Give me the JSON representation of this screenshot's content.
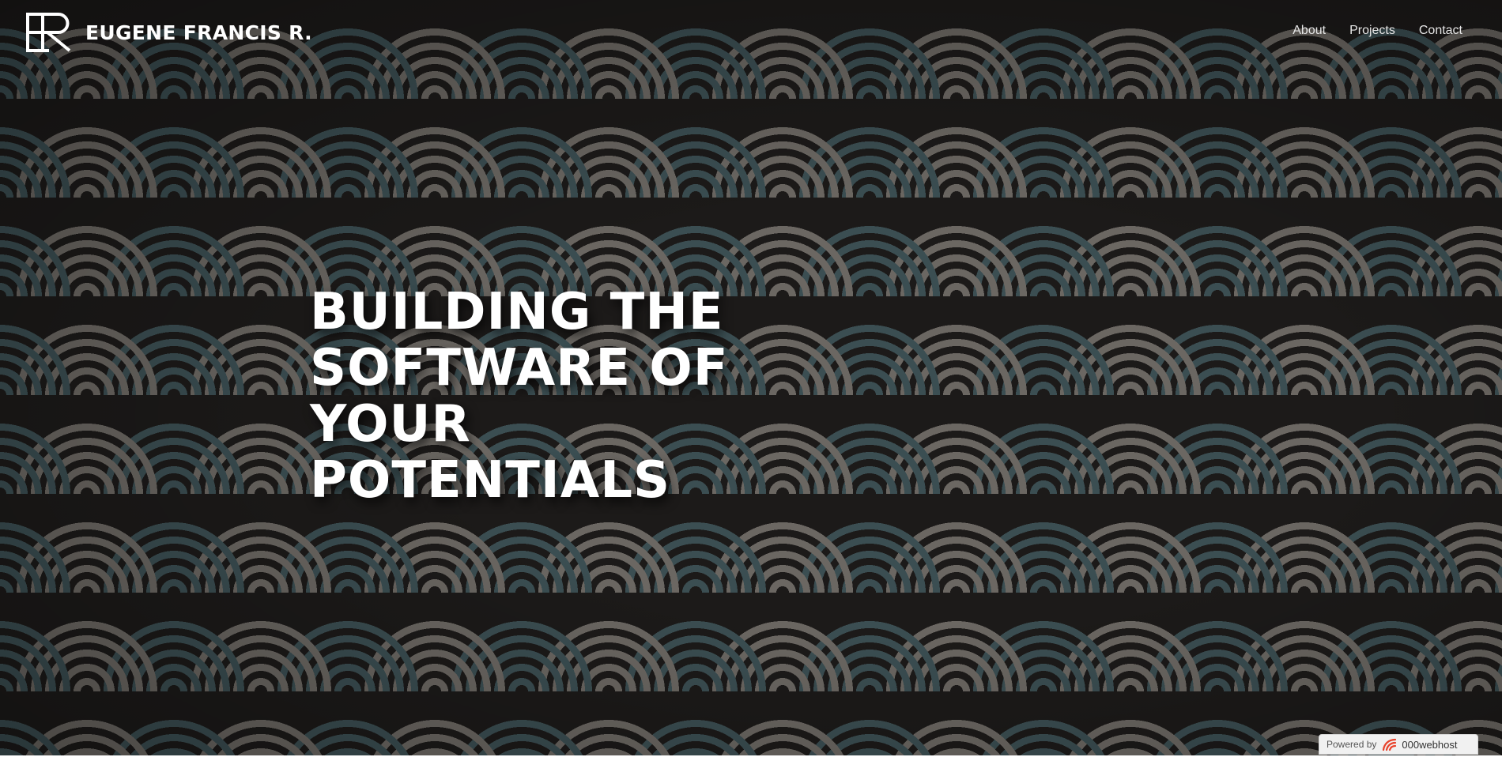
{
  "brand": {
    "logo_text": "ER",
    "name": "EUGENE FRANCIS R."
  },
  "nav": {
    "items": [
      {
        "label": "About"
      },
      {
        "label": "Projects"
      },
      {
        "label": "Contact"
      }
    ]
  },
  "hero": {
    "headline_lines": [
      "BUILDING THE",
      "SOFTWARE OF",
      "YOUR",
      "POTENTIALS"
    ]
  },
  "footer_badge": {
    "powered_label": "Powered by",
    "host_name": "000webhost",
    "icon": "000webhost-logo-icon"
  },
  "colors": {
    "wave_gray": "#6b6762",
    "wave_teal": "#3b4e52",
    "background": "#1c1a19",
    "text": "#ffffff",
    "host_logo_red": "#e8432c"
  }
}
